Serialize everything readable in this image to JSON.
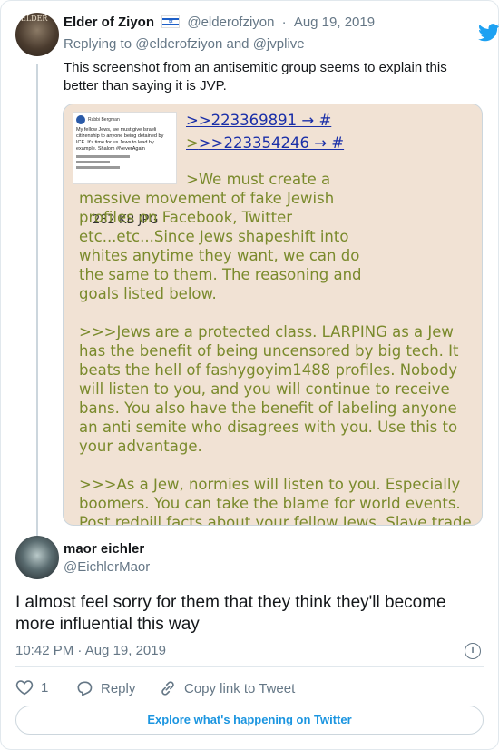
{
  "parent_tweet": {
    "display_name": "Elder of Ziyon",
    "flag": "israel-flag",
    "handle": "@elderofziyon",
    "date": "Aug 19, 2019",
    "replying_label": "Replying to",
    "reply_handle_1": "@elderofziyon",
    "reply_and": "and",
    "reply_handle_2": "@jvplive",
    "text": "This screenshot from an antisemitic group seems to explain this better than saying it is JVP.",
    "avatar_text": "ELDER"
  },
  "media": {
    "thumb_name": "Rabbi Bergman",
    "thumb_text": "My fellow Jews, we must give Israeli citizenship to anyone being detained by ICE. It's time for us Jews to lead by example. Shalom #NeverAgain",
    "file_size": "282 KB JPG",
    "quote_link_1": ">>223369891 → #",
    "quote_link_2_prefix": ">",
    "quote_link_2": ">>223354246 → #",
    "paragraph_1": ">We must create a massive movement of fake Jewish profiles on Facebook, Twitter etc...etc...Since Jews shapeshift into whites anytime they want, we can do the same to them. The reasoning and goals listed below.",
    "paragraph_2": ">>>Jews are a protected class. LARPING as a Jew has the benefit of being uncensored by big tech. It beats the hell of fashygoyim1488 profiles. Nobody will listen to you, and you will continue to receive bans. You also have the benefit of labeling anyone an anti semite who disagrees with you. Use this to your advantage.",
    "paragraph_3": ">>>As a Jew, normies will listen to you. Especially boomers. You can take the blame for world events. Post redpill facts about your fellow Jews. Slave trade, monetary facts, mass media, porn industry"
  },
  "reply_tweet": {
    "display_name": "maor eichler",
    "handle": "@EichlerMaor",
    "text": "I almost feel sorry for them that they think they'll become more influential this way",
    "timestamp": "10:42 PM · Aug 19, 2019",
    "info_label": "i"
  },
  "actions": {
    "like_count": "1",
    "reply_label": "Reply",
    "copy_link_label": "Copy link to Tweet"
  },
  "footer": {
    "explore_label": "Explore what's happening on Twitter"
  },
  "colors": {
    "twitter_blue": "#1da1f2",
    "greentext": "#7a8a2c",
    "quotelink": "#1a2fa8",
    "image_bg": "#f1e2d4"
  }
}
